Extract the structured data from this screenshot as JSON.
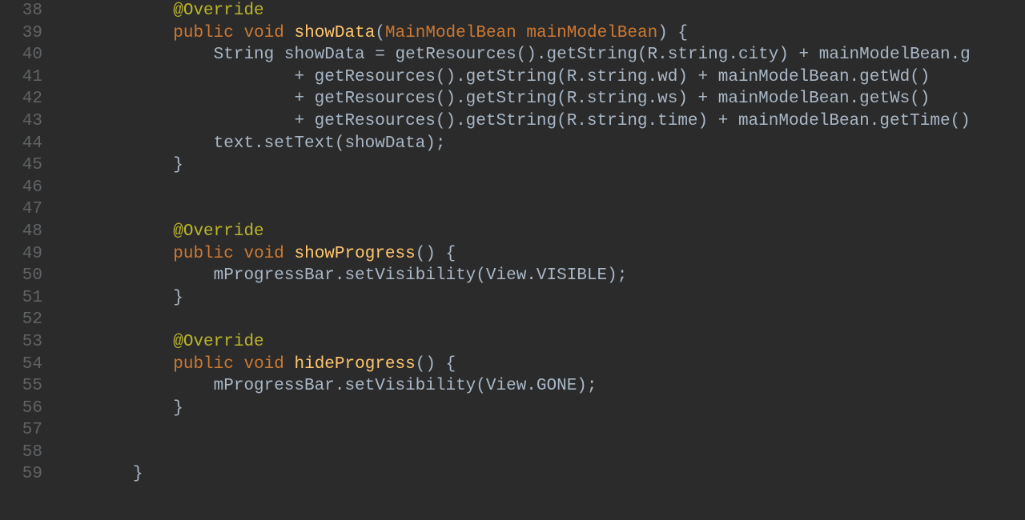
{
  "lines": [
    {
      "num": "38",
      "tokens": [
        {
          "c": "            ",
          "cls": ""
        },
        {
          "c": "@Override",
          "cls": "ann"
        }
      ]
    },
    {
      "num": "39",
      "tokens": [
        {
          "c": "            ",
          "cls": ""
        },
        {
          "c": "public",
          "cls": "kw"
        },
        {
          "c": " ",
          "cls": ""
        },
        {
          "c": "void",
          "cls": "kw"
        },
        {
          "c": " ",
          "cls": ""
        },
        {
          "c": "showData",
          "cls": "fn"
        },
        {
          "c": "(",
          "cls": "paren"
        },
        {
          "c": "MainModelBean",
          "cls": "kw"
        },
        {
          "c": " ",
          "cls": ""
        },
        {
          "c": "mainModelBean",
          "cls": "kw"
        },
        {
          "c": ")",
          "cls": "paren"
        },
        {
          "c": " {",
          "cls": ""
        }
      ]
    },
    {
      "num": "40",
      "tokens": [
        {
          "c": "                String showData = getResources().getString(R.string.city) + mainModelBean.g",
          "cls": ""
        }
      ]
    },
    {
      "num": "41",
      "tokens": [
        {
          "c": "                        + getResources().getString(R.string.wd) + mainModelBean.getWd()",
          "cls": ""
        }
      ]
    },
    {
      "num": "42",
      "tokens": [
        {
          "c": "                        + getResources().getString(R.string.ws) + mainModelBean.getWs()",
          "cls": ""
        }
      ]
    },
    {
      "num": "43",
      "tokens": [
        {
          "c": "                        + getResources().getString(R.string.time) + mainModelBean.getTime()",
          "cls": ""
        }
      ]
    },
    {
      "num": "44",
      "tokens": [
        {
          "c": "                text.setText(showData);",
          "cls": ""
        }
      ]
    },
    {
      "num": "45",
      "tokens": [
        {
          "c": "            }",
          "cls": ""
        }
      ]
    },
    {
      "num": "46",
      "tokens": [
        {
          "c": "",
          "cls": ""
        }
      ]
    },
    {
      "num": "47",
      "tokens": [
        {
          "c": "",
          "cls": ""
        }
      ]
    },
    {
      "num": "48",
      "tokens": [
        {
          "c": "            ",
          "cls": ""
        },
        {
          "c": "@Override",
          "cls": "ann"
        }
      ]
    },
    {
      "num": "49",
      "tokens": [
        {
          "c": "            ",
          "cls": ""
        },
        {
          "c": "public",
          "cls": "kw"
        },
        {
          "c": " ",
          "cls": ""
        },
        {
          "c": "void",
          "cls": "kw"
        },
        {
          "c": " ",
          "cls": ""
        },
        {
          "c": "showProgress",
          "cls": "fn"
        },
        {
          "c": "()",
          "cls": "paren"
        },
        {
          "c": " {",
          "cls": ""
        }
      ]
    },
    {
      "num": "50",
      "tokens": [
        {
          "c": "                mProgressBar.setVisibility(View.VISIBLE);",
          "cls": ""
        }
      ]
    },
    {
      "num": "51",
      "tokens": [
        {
          "c": "            }",
          "cls": ""
        }
      ]
    },
    {
      "num": "52",
      "tokens": [
        {
          "c": "",
          "cls": ""
        }
      ]
    },
    {
      "num": "53",
      "tokens": [
        {
          "c": "            ",
          "cls": ""
        },
        {
          "c": "@Override",
          "cls": "ann"
        }
      ]
    },
    {
      "num": "54",
      "tokens": [
        {
          "c": "            ",
          "cls": ""
        },
        {
          "c": "public",
          "cls": "kw"
        },
        {
          "c": " ",
          "cls": ""
        },
        {
          "c": "void",
          "cls": "kw"
        },
        {
          "c": " ",
          "cls": ""
        },
        {
          "c": "hideProgress",
          "cls": "fn"
        },
        {
          "c": "()",
          "cls": "paren"
        },
        {
          "c": " {",
          "cls": ""
        }
      ]
    },
    {
      "num": "55",
      "tokens": [
        {
          "c": "                mProgressBar.setVisibility(View.GONE);",
          "cls": ""
        }
      ]
    },
    {
      "num": "56",
      "tokens": [
        {
          "c": "            }",
          "cls": ""
        }
      ]
    },
    {
      "num": "57",
      "tokens": [
        {
          "c": "",
          "cls": ""
        }
      ]
    },
    {
      "num": "58",
      "tokens": [
        {
          "c": "",
          "cls": ""
        }
      ]
    },
    {
      "num": "59",
      "tokens": [
        {
          "c": "        }",
          "cls": ""
        }
      ]
    }
  ]
}
